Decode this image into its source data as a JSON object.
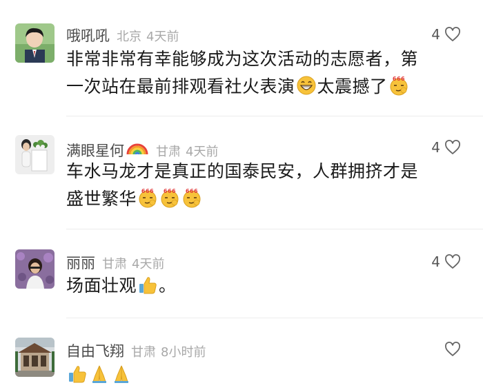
{
  "comments": [
    {
      "username": "哦吼吼",
      "location": "北京",
      "time": "4天前",
      "likes": "4",
      "text_line1": "非常非常有幸能够成为这次活动的志愿者，第",
      "text_line2_a": "一次站在最前排观看社火表演",
      "text_line2_b": "太震撼了",
      "emojis": [
        "grin-emoji",
        "666-emoji"
      ]
    },
    {
      "username": "满眼星何",
      "location": "甘肃",
      "time": "4天前",
      "likes": "4",
      "text_line1": "车水马龙才是真正的国泰民安，人群拥挤才是",
      "text_line2": "盛世繁华",
      "emojis": [
        "666-emoji",
        "666-emoji",
        "666-emoji"
      ]
    },
    {
      "username": "丽丽",
      "location": "甘肃",
      "time": "4天前",
      "likes": "4",
      "text_a": "场面壮观",
      "text_b": "。",
      "emojis": [
        "thumbs-up-emoji"
      ]
    },
    {
      "username": "自由飞翔",
      "location": "甘肃",
      "time": "8小时前",
      "likes": "",
      "emojis": [
        "thumbs-up-emoji",
        "folded-hands-emoji",
        "folded-hands-emoji"
      ]
    }
  ],
  "colors": {
    "username": "#4a4a4a",
    "meta": "#a8a8a8",
    "text": "#1a1a1a",
    "divider": "#ececec",
    "emoji_yellow": "#f7c23a"
  }
}
